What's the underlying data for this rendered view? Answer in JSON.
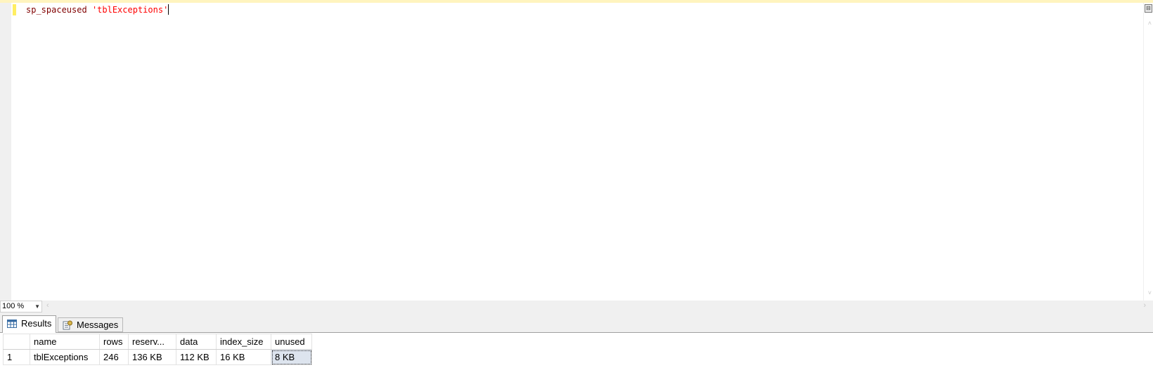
{
  "editor": {
    "proc_name": "sp_spaceused",
    "space": " ",
    "string_arg": "'tblExceptions'"
  },
  "zoom": {
    "value": "100 %"
  },
  "tabs": {
    "results_label": "Results",
    "messages_label": "Messages"
  },
  "results": {
    "columns": [
      "name",
      "rows",
      "reserv...",
      "data",
      "index_size",
      "unused"
    ],
    "rows": [
      {
        "row_number": "1",
        "cells": [
          "tblExceptions",
          "246",
          "136 KB",
          "112 KB",
          "16 KB",
          "8 KB"
        ]
      }
    ]
  },
  "colors": {
    "proc_color": "#800000",
    "string_color": "#ff0000",
    "change_marker": "#ffee62",
    "selected_cell": "#dde4ee"
  }
}
